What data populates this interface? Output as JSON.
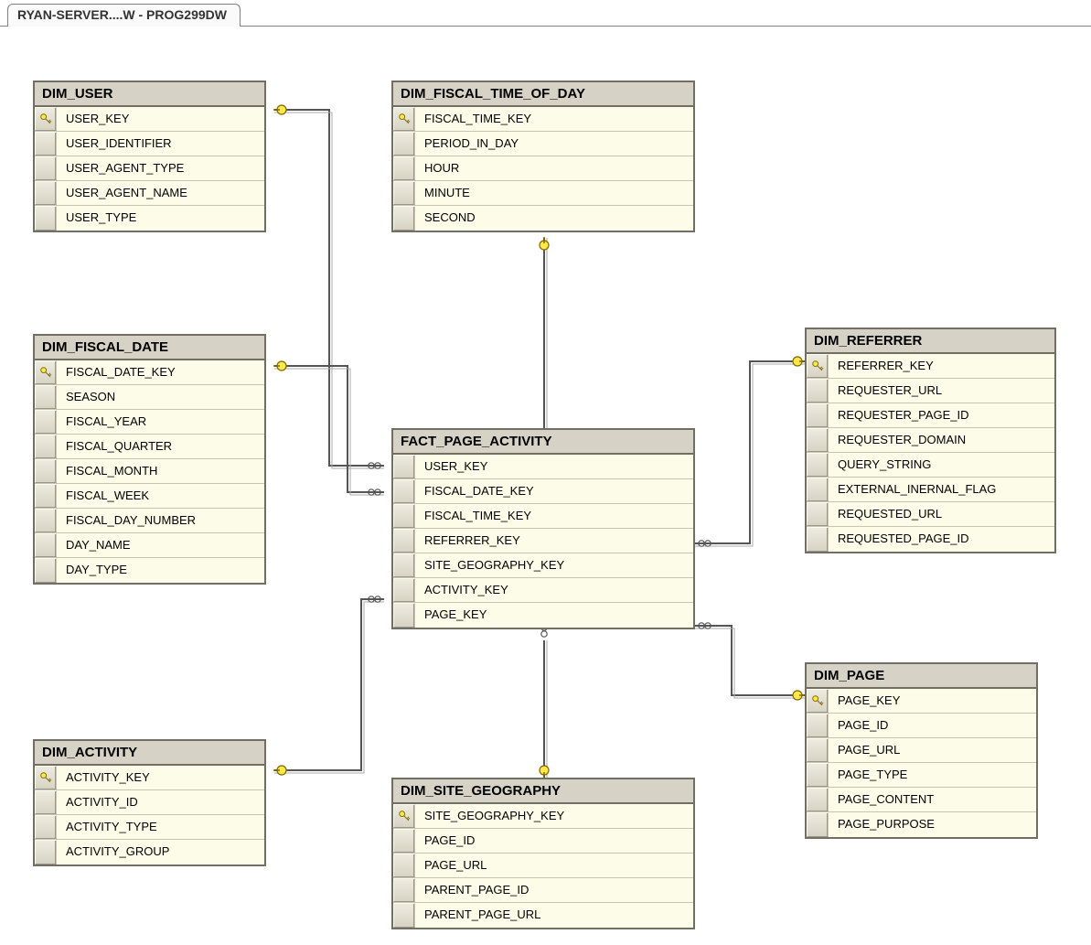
{
  "tab_label": "RYAN-SERVER....W - PROG299DW",
  "tables": {
    "dim_user": {
      "title": "DIM_USER",
      "cols": [
        {
          "name": "USER_KEY",
          "pk": true
        },
        {
          "name": "USER_IDENTIFIER",
          "pk": false
        },
        {
          "name": "USER_AGENT_TYPE",
          "pk": false
        },
        {
          "name": "USER_AGENT_NAME",
          "pk": false
        },
        {
          "name": "USER_TYPE",
          "pk": false
        }
      ]
    },
    "dim_fiscal_time_of_day": {
      "title": "DIM_FISCAL_TIME_OF_DAY",
      "cols": [
        {
          "name": "FISCAL_TIME_KEY",
          "pk": true
        },
        {
          "name": "PERIOD_IN_DAY",
          "pk": false
        },
        {
          "name": "HOUR",
          "pk": false
        },
        {
          "name": "MINUTE",
          "pk": false
        },
        {
          "name": "SECOND",
          "pk": false
        }
      ]
    },
    "dim_fiscal_date": {
      "title": "DIM_FISCAL_DATE",
      "cols": [
        {
          "name": "FISCAL_DATE_KEY",
          "pk": true
        },
        {
          "name": "SEASON",
          "pk": false
        },
        {
          "name": "FISCAL_YEAR",
          "pk": false
        },
        {
          "name": "FISCAL_QUARTER",
          "pk": false
        },
        {
          "name": "FISCAL_MONTH",
          "pk": false
        },
        {
          "name": "FISCAL_WEEK",
          "pk": false
        },
        {
          "name": "FISCAL_DAY_NUMBER",
          "pk": false
        },
        {
          "name": "DAY_NAME",
          "pk": false
        },
        {
          "name": "DAY_TYPE",
          "pk": false
        }
      ]
    },
    "dim_referrer": {
      "title": "DIM_REFERRER",
      "cols": [
        {
          "name": "REFERRER_KEY",
          "pk": true
        },
        {
          "name": "REQUESTER_URL",
          "pk": false
        },
        {
          "name": "REQUESTER_PAGE_ID",
          "pk": false
        },
        {
          "name": "REQUESTER_DOMAIN",
          "pk": false
        },
        {
          "name": "QUERY_STRING",
          "pk": false
        },
        {
          "name": "EXTERNAL_INERNAL_FLAG",
          "pk": false
        },
        {
          "name": "REQUESTED_URL",
          "pk": false
        },
        {
          "name": "REQUESTED_PAGE_ID",
          "pk": false
        }
      ]
    },
    "fact_page_activity": {
      "title": "FACT_PAGE_ACTIVITY",
      "cols": [
        {
          "name": "USER_KEY",
          "pk": false
        },
        {
          "name": "FISCAL_DATE_KEY",
          "pk": false
        },
        {
          "name": "FISCAL_TIME_KEY",
          "pk": false
        },
        {
          "name": "REFERRER_KEY",
          "pk": false
        },
        {
          "name": "SITE_GEOGRAPHY_KEY",
          "pk": false
        },
        {
          "name": "ACTIVITY_KEY",
          "pk": false
        },
        {
          "name": "PAGE_KEY",
          "pk": false
        }
      ]
    },
    "dim_activity": {
      "title": "DIM_ACTIVITY",
      "cols": [
        {
          "name": "ACTIVITY_KEY",
          "pk": true
        },
        {
          "name": "ACTIVITY_ID",
          "pk": false
        },
        {
          "name": "ACTIVITY_TYPE",
          "pk": false
        },
        {
          "name": "ACTIVITY_GROUP",
          "pk": false
        }
      ]
    },
    "dim_site_geography": {
      "title": "DIM_SITE_GEOGRAPHY",
      "cols": [
        {
          "name": "SITE_GEOGRAPHY_KEY",
          "pk": true
        },
        {
          "name": "PAGE_ID",
          "pk": false
        },
        {
          "name": "PAGE_URL",
          "pk": false
        },
        {
          "name": "PARENT_PAGE_ID",
          "pk": false
        },
        {
          "name": "PARENT_PAGE_URL",
          "pk": false
        }
      ]
    },
    "dim_page": {
      "title": "DIM_PAGE",
      "cols": [
        {
          "name": "PAGE_KEY",
          "pk": true
        },
        {
          "name": "PAGE_ID",
          "pk": false
        },
        {
          "name": "PAGE_URL",
          "pk": false
        },
        {
          "name": "PAGE_TYPE",
          "pk": false
        },
        {
          "name": "PAGE_CONTENT",
          "pk": false
        },
        {
          "name": "PAGE_PURPOSE",
          "pk": false
        }
      ]
    }
  },
  "connectors": [
    {
      "from": "dim_user",
      "to": "fact_page_activity"
    },
    {
      "from": "dim_fiscal_time_of_day",
      "to": "fact_page_activity"
    },
    {
      "from": "dim_fiscal_date",
      "to": "fact_page_activity"
    },
    {
      "from": "dim_referrer",
      "to": "fact_page_activity"
    },
    {
      "from": "dim_activity",
      "to": "fact_page_activity"
    },
    {
      "from": "dim_site_geography",
      "to": "fact_page_activity"
    },
    {
      "from": "dim_page",
      "to": "fact_page_activity"
    }
  ]
}
